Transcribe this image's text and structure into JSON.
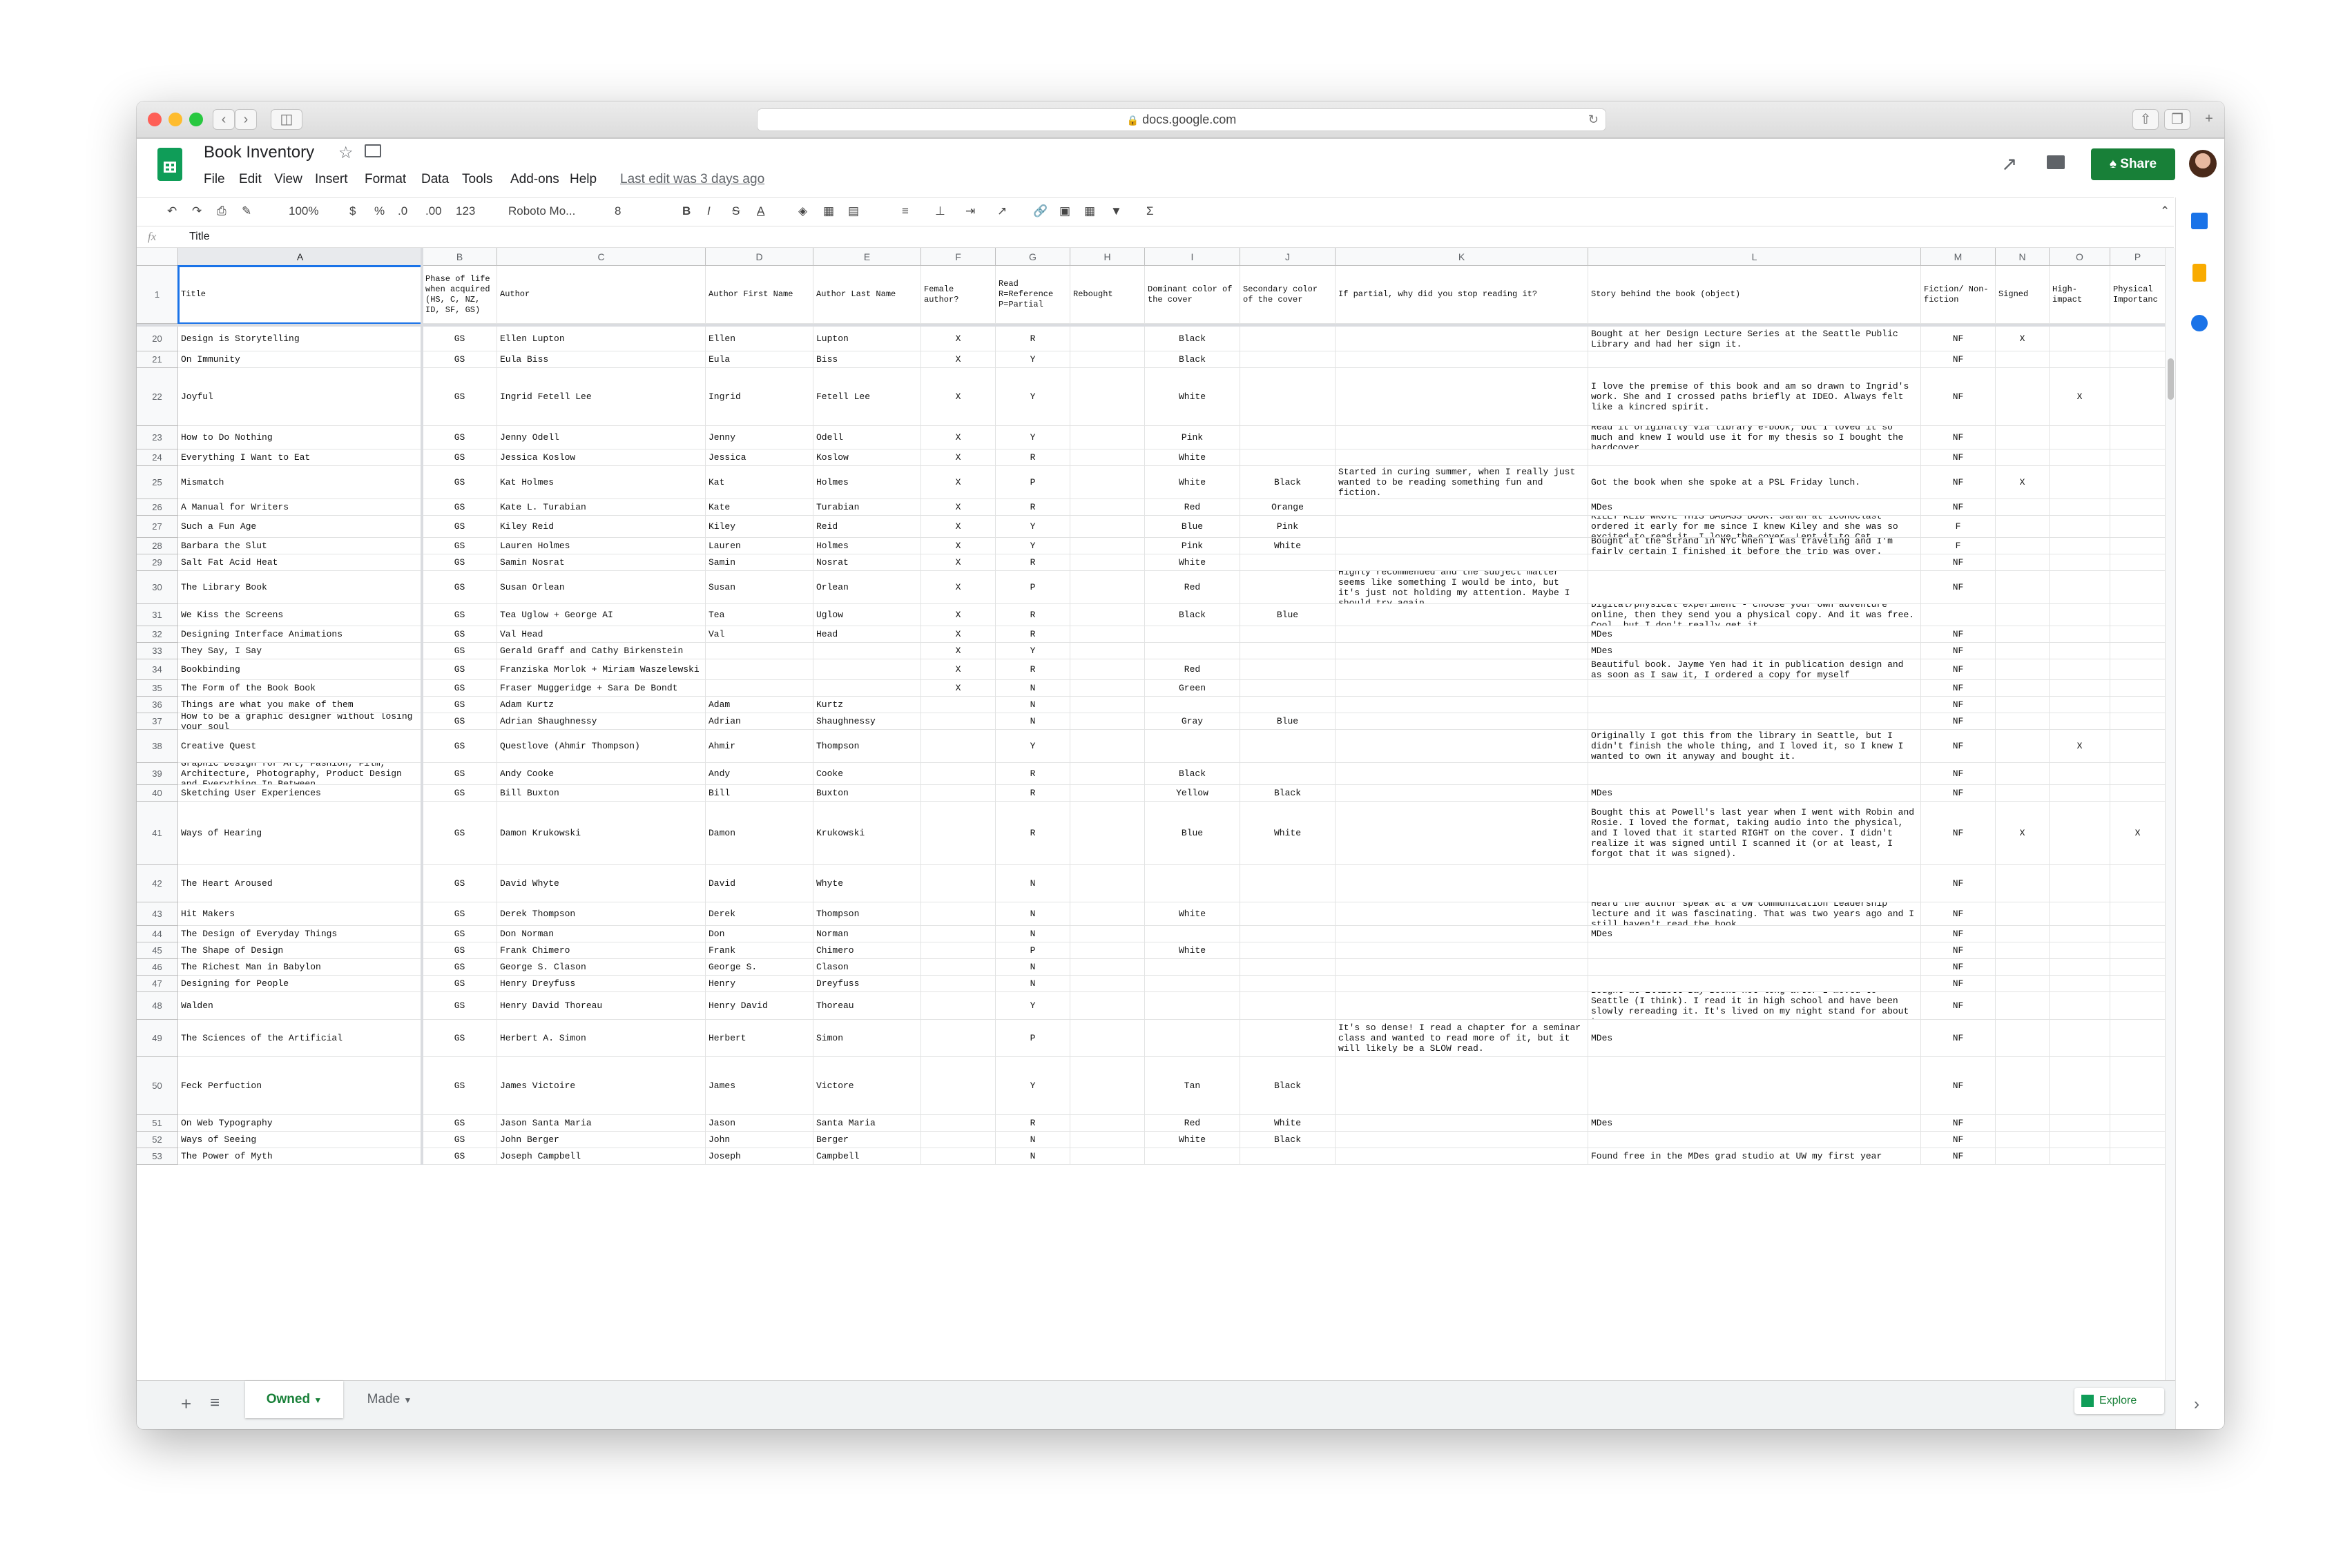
{
  "browser": {
    "url": "docs.google.com"
  },
  "doc": {
    "title": "Book Inventory",
    "menus": [
      "File",
      "Edit",
      "View",
      "Insert",
      "Format",
      "Data",
      "Tools",
      "Add-ons",
      "Help"
    ],
    "last_edit": "Last edit was 3 days ago",
    "share_label": "Share"
  },
  "toolbar": {
    "zoom": "100%",
    "currency": "$",
    "percent": "%",
    "dec_less": ".0",
    "dec_more": ".00",
    "format_more": "123",
    "font": "Roboto Mo...",
    "font_size": "8"
  },
  "formula": {
    "fx": "fx",
    "value": "Title"
  },
  "columns": [
    "A",
    "B",
    "C",
    "D",
    "E",
    "F",
    "G",
    "H",
    "I",
    "J",
    "K",
    "L",
    "M",
    "N",
    "O",
    "P"
  ],
  "header_row": {
    "num": "1",
    "cells": [
      "Title",
      "Phase of life when acquired (HS, C, NZ, ID, SF, GS)",
      "Author",
      "Author First Name",
      "Author Last Name",
      "Female author?",
      "Read R=Reference P=Partial",
      "Rebought",
      "Dominant color of the cover",
      "Secondary color of the cover",
      "If partial, why did you stop reading it?",
      "Story behind the book (object)",
      "Fiction/ Non-fiction",
      "Signed",
      "High-impact",
      "Physical Importanc"
    ]
  },
  "rows": [
    {
      "num": "20",
      "c": [
        "Design is Storytelling",
        "GS",
        "Ellen Lupton",
        "Ellen",
        "Lupton",
        "X",
        "R",
        "",
        "Black",
        "",
        "",
        "Bought at her Design Lecture Series at the Seattle Public Library and had her sign it.",
        "NF",
        "X",
        "",
        ""
      ]
    },
    {
      "num": "21",
      "c": [
        "On Immunity",
        "GS",
        "Eula Biss",
        "Eula",
        "Biss",
        "X",
        "Y",
        "",
        "Black",
        "",
        "",
        "",
        "NF",
        "",
        "",
        ""
      ]
    },
    {
      "num": "22",
      "c": [
        "Joyful",
        "GS",
        "Ingrid Fetell Lee",
        "Ingrid",
        "Fetell Lee",
        "X",
        "Y",
        "",
        "White",
        "",
        "",
        "I love the premise of this book and am so drawn to Ingrid's work. She and I crossed paths briefly at IDEO. Always felt like a kincred spirit.",
        "NF",
        "",
        "X",
        ""
      ]
    },
    {
      "num": "23",
      "c": [
        "How to Do Nothing",
        "GS",
        "Jenny Odell",
        "Jenny",
        "Odell",
        "X",
        "Y",
        "",
        "Pink",
        "",
        "",
        "Read it originally via library e-book, but I loved it so much and knew I would use it for my thesis so I bought the hardcover.",
        "NF",
        "",
        "",
        ""
      ]
    },
    {
      "num": "24",
      "c": [
        "Everything I Want to Eat",
        "GS",
        "Jessica Koslow",
        "Jessica",
        "Koslow",
        "X",
        "R",
        "",
        "White",
        "",
        "",
        "",
        "NF",
        "",
        "",
        ""
      ]
    },
    {
      "num": "25",
      "c": [
        "Mismatch",
        "GS",
        "Kat Holmes",
        "Kat",
        "Holmes",
        "X",
        "P",
        "",
        "White",
        "Black",
        "Started in curing summer, when I really just wanted to be reading something fun and fiction.",
        "Got the book when she spoke at a PSL Friday lunch.",
        "NF",
        "X",
        "",
        ""
      ]
    },
    {
      "num": "26",
      "c": [
        "A Manual for Writers",
        "GS",
        "Kate L. Turabian",
        "Kate",
        "Turabian",
        "X",
        "R",
        "",
        "Red",
        "Orange",
        "",
        "MDes",
        "NF",
        "",
        "",
        ""
      ]
    },
    {
      "num": "27",
      "c": [
        "Such a Fun Age",
        "GS",
        "Kiley Reid",
        "Kiley",
        "Reid",
        "X",
        "Y",
        "",
        "Blue",
        "Pink",
        "",
        "KILEY REID WROTE THIS BADASS BOOK. Sarah at Iconoclast ordered it early for me since I knew Kiley and she was so excited to read it. I love the cover. Lent it to Cat.",
        "F",
        "",
        "",
        ""
      ]
    },
    {
      "num": "28",
      "c": [
        "Barbara the Slut",
        "GS",
        "Lauren Holmes",
        "Lauren",
        "Holmes",
        "X",
        "Y",
        "",
        "Pink",
        "White",
        "",
        "Bought at the Strand in NYC when I was traveling and I'm fairly certain I finished it before the trip was over.",
        "F",
        "",
        "",
        ""
      ]
    },
    {
      "num": "29",
      "c": [
        "Salt Fat Acid Heat",
        "GS",
        "Samin Nosrat",
        "Samin",
        "Nosrat",
        "X",
        "R",
        "",
        "White",
        "",
        "",
        "",
        "NF",
        "",
        "",
        ""
      ]
    },
    {
      "num": "30",
      "c": [
        "The Library Book",
        "GS",
        "Susan Orlean",
        "Susan",
        "Orlean",
        "X",
        "P",
        "",
        "Red",
        "",
        "Highly recommended and the subject matter seems like something I would be into, but it's just not holding my attention. Maybe I should try again.",
        "",
        "NF",
        "",
        "",
        ""
      ]
    },
    {
      "num": "31",
      "c": [
        "We Kiss the Screens",
        "GS",
        "Tea Uglow + George AI",
        "Tea",
        "Uglow",
        "X",
        "R",
        "",
        "Black",
        "Blue",
        "",
        "Digital/physical experiment - choose your own adventure online, then they send you a physical copy. And it was free. Cool, but I don't really get it.",
        "",
        "",
        "",
        ""
      ]
    },
    {
      "num": "32",
      "c": [
        "Designing Interface Animations",
        "GS",
        "Val Head",
        "Val",
        "Head",
        "X",
        "R",
        "",
        "",
        "",
        "",
        "MDes",
        "NF",
        "",
        "",
        ""
      ]
    },
    {
      "num": "33",
      "c": [
        "They Say, I Say",
        "GS",
        "Gerald Graff and Cathy Birkenstein",
        "",
        "",
        "X",
        "Y",
        "",
        "",
        "",
        "",
        "MDes",
        "NF",
        "",
        "",
        ""
      ]
    },
    {
      "num": "34",
      "c": [
        "Bookbinding",
        "GS",
        "Franziska Morlok + Miriam Waszelewski",
        "",
        "",
        "X",
        "R",
        "",
        "Red",
        "",
        "",
        "Beautiful book. Jayme Yen had it in publication design and as soon as I saw it, I ordered a copy for myself",
        "NF",
        "",
        "",
        ""
      ]
    },
    {
      "num": "35",
      "c": [
        "The Form of the Book Book",
        "GS",
        "Fraser Muggeridge + Sara De Bondt",
        "",
        "",
        "X",
        "N",
        "",
        "Green",
        "",
        "",
        "",
        "NF",
        "",
        "",
        ""
      ]
    },
    {
      "num": "36",
      "c": [
        "Things are what you make of them",
        "GS",
        "Adam Kurtz",
        "Adam",
        "Kurtz",
        "",
        "N",
        "",
        "",
        "",
        "",
        "",
        "NF",
        "",
        "",
        ""
      ]
    },
    {
      "num": "37",
      "c": [
        "How to be a graphic designer without losing your soul",
        "GS",
        "Adrian Shaughnessy",
        "Adrian",
        "Shaughnessy",
        "",
        "N",
        "",
        "Gray",
        "Blue",
        "",
        "",
        "NF",
        "",
        "",
        ""
      ]
    },
    {
      "num": "38",
      "c": [
        "Creative Quest",
        "GS",
        "Questlove (Ahmir Thompson)",
        "Ahmir",
        "Thompson",
        "",
        "Y",
        "",
        "",
        "",
        "",
        "Originally I got this from the library in Seattle, but I didn't finish the whole thing, and I loved it, so I knew I wanted to own it anyway and bought it.",
        "NF",
        "",
        "X",
        ""
      ]
    },
    {
      "num": "39",
      "c": [
        "Graphic Design for Art, Fashion, Film, Architecture, Photography, Product Design and Everything In Between",
        "GS",
        "Andy Cooke",
        "Andy",
        "Cooke",
        "",
        "R",
        "",
        "Black",
        "",
        "",
        "",
        "NF",
        "",
        "",
        ""
      ]
    },
    {
      "num": "40",
      "c": [
        "Sketching User Experiences",
        "GS",
        "Bill Buxton",
        "Bill",
        "Buxton",
        "",
        "R",
        "",
        "Yellow",
        "Black",
        "",
        "MDes",
        "NF",
        "",
        "",
        ""
      ]
    },
    {
      "num": "41",
      "c": [
        "Ways of Hearing",
        "GS",
        "Damon Krukowski",
        "Damon",
        "Krukowski",
        "",
        "R",
        "",
        "Blue",
        "White",
        "",
        "Bought this at Powell's last year when I went with Robin and Rosie. I loved the format, taking audio into the physical, and I loved that it started RIGHT on the cover. I didn't realize it was signed until I scanned it (or at least, I forgot that it was signed).",
        "NF",
        "X",
        "",
        "X"
      ]
    },
    {
      "num": "42",
      "c": [
        "The Heart Aroused",
        "GS",
        "David Whyte",
        "David",
        "Whyte",
        "",
        "N",
        "",
        "",
        "",
        "",
        "",
        "NF",
        "",
        "",
        ""
      ]
    },
    {
      "num": "43",
      "c": [
        "Hit Makers",
        "GS",
        "Derek Thompson",
        "Derek",
        "Thompson",
        "",
        "N",
        "",
        "White",
        "",
        "",
        "Heard the author speak at a UW Communication Leadership lecture and it was fascinating. That was two years ago and I still haven't read the book.",
        "NF",
        "",
        "",
        ""
      ]
    },
    {
      "num": "44",
      "c": [
        "The Design of Everyday Things",
        "GS",
        "Don Norman",
        "Don",
        "Norman",
        "",
        "N",
        "",
        "",
        "",
        "",
        "MDes",
        "NF",
        "",
        "",
        ""
      ]
    },
    {
      "num": "45",
      "c": [
        "The Shape of Design",
        "GS",
        "Frank Chimero",
        "Frank",
        "Chimero",
        "",
        "P",
        "",
        "White",
        "",
        "",
        "",
        "NF",
        "",
        "",
        ""
      ]
    },
    {
      "num": "46",
      "c": [
        "The Richest Man in Babylon",
        "GS",
        "George S. Clason",
        "George S.",
        "Clason",
        "",
        "N",
        "",
        "",
        "",
        "",
        "",
        "NF",
        "",
        "",
        ""
      ]
    },
    {
      "num": "47",
      "c": [
        "Designing for People",
        "GS",
        "Henry Dreyfuss",
        "Henry",
        "Dreyfuss",
        "",
        "N",
        "",
        "",
        "",
        "",
        "",
        "NF",
        "",
        "",
        ""
      ]
    },
    {
      "num": "48",
      "c": [
        "Walden",
        "GS",
        "Henry David Thoreau",
        "Henry David",
        "Thoreau",
        "",
        "Y",
        "",
        "",
        "",
        "",
        "Bought at Elliott Bay Books not long after I moved to Seattle (I think). I read it in high school and have been slowly rereading it. It's lived on my night stand for about two years.",
        "NF",
        "",
        "",
        ""
      ]
    },
    {
      "num": "49",
      "c": [
        "The Sciences of the Artificial",
        "GS",
        "Herbert A. Simon",
        "Herbert",
        "Simon",
        "",
        "P",
        "",
        "",
        "",
        "It's so dense! I read a chapter for a seminar class and wanted to read more of it, but it will likely be a SLOW read.",
        "MDes",
        "NF",
        "",
        "",
        ""
      ]
    },
    {
      "num": "50",
      "c": [
        "Feck Perfuction",
        "GS",
        "James Victoire",
        "James",
        "Victore",
        "",
        "Y",
        "",
        "Tan",
        "Black",
        "",
        "",
        "NF",
        "",
        "",
        ""
      ]
    },
    {
      "num": "51",
      "c": [
        "On Web Typography",
        "GS",
        "Jason Santa Maria",
        "Jason",
        "Santa Maria",
        "",
        "R",
        "",
        "Red",
        "White",
        "",
        "MDes",
        "NF",
        "",
        "",
        ""
      ]
    },
    {
      "num": "52",
      "c": [
        "Ways of Seeing",
        "GS",
        "John Berger",
        "John",
        "Berger",
        "",
        "N",
        "",
        "White",
        "Black",
        "",
        "",
        "NF",
        "",
        "",
        ""
      ]
    },
    {
      "num": "53",
      "c": [
        "The Power of Myth",
        "GS",
        "Joseph Campbell",
        "Joseph",
        "Campbell",
        "",
        "N",
        "",
        "",
        "",
        "",
        "Found free in the MDes grad studio at UW my first year",
        "NF",
        "",
        "",
        ""
      ]
    }
  ],
  "sheets": {
    "active": "Owned",
    "other": "Made",
    "explore": "Explore"
  },
  "colors": {
    "green": "#0f9d58",
    "share": "#188038",
    "select": "#1a73e8"
  }
}
